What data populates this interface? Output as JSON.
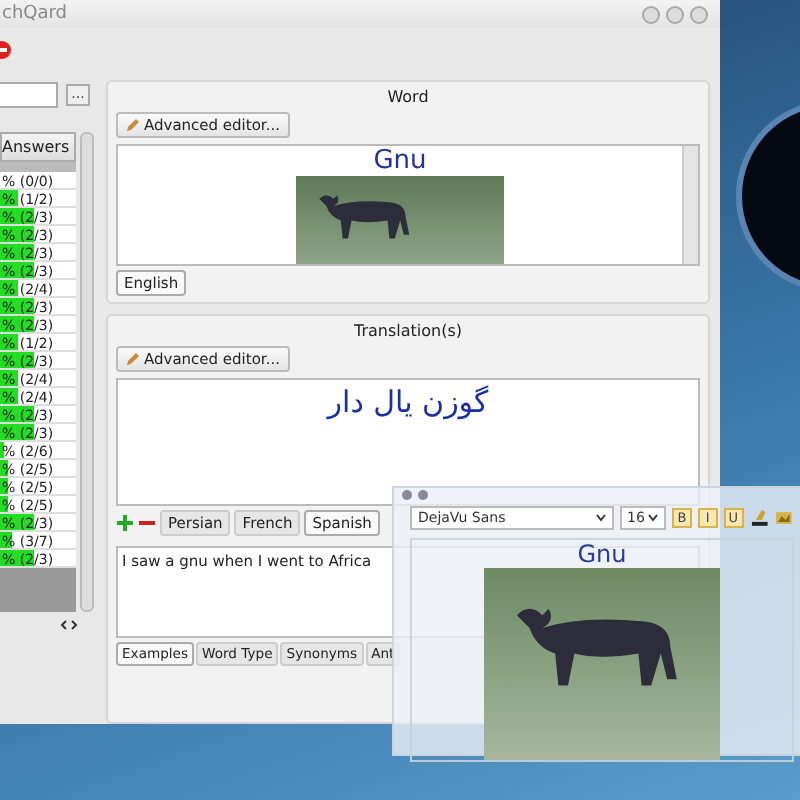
{
  "window": {
    "title": "chQard"
  },
  "search": {
    "button": "..."
  },
  "table": {
    "columns": [
      "Answers"
    ],
    "rows": [
      {
        "answers": "% (0/0)"
      },
      {
        "answers": "% (1/2)",
        "level": 0.25
      },
      {
        "answers": "% (2/3)",
        "level": 0.45
      },
      {
        "answers": "% (2/3)",
        "level": 0.45
      },
      {
        "answers": "% (2/3)",
        "level": 0.45
      },
      {
        "answers": "% (2/3)",
        "level": 0.45
      },
      {
        "answers": "% (2/4)",
        "level": 0.25
      },
      {
        "answers": "% (2/3)",
        "level": 0.45
      },
      {
        "answers": "% (2/3)",
        "level": 0.45
      },
      {
        "answers": "% (1/2)",
        "level": 0.25
      },
      {
        "answers": "% (2/3)",
        "level": 0.45
      },
      {
        "answers": "% (2/4)",
        "level": 0.25
      },
      {
        "answers": "% (2/4)",
        "level": 0.25
      },
      {
        "answers": "% (2/3)",
        "level": 0.45
      },
      {
        "answers": "% (2/3)",
        "level": 0.45
      },
      {
        "answers": "% (2/6)",
        "level": 0.05
      },
      {
        "answers": "% (2/5)",
        "level": 0.1
      },
      {
        "answers": "% (2/5)",
        "level": 0.1
      },
      {
        "answers": "% (2/5)",
        "level": 0.1
      },
      {
        "answers": "% (2/3)",
        "level": 0.45
      },
      {
        "answers": "% (3/7)",
        "level": 0.15
      },
      {
        "answers": "% (2/3)",
        "level": 0.45
      }
    ]
  },
  "word_panel": {
    "title": "Word",
    "editor_button": "Advanced editor...",
    "word": "Gnu",
    "tabs": [
      {
        "label": "English",
        "selected": true
      }
    ]
  },
  "translation_panel": {
    "title": "Translation(s)",
    "editor_button": "Advanced editor...",
    "translation": "گوزن یال دار",
    "tabs": [
      {
        "label": "Persian",
        "selected": false
      },
      {
        "label": "French",
        "selected": false
      },
      {
        "label": "Spanish",
        "selected": true
      }
    ]
  },
  "example": {
    "text": "I saw a gnu when I went to Africa"
  },
  "bottom_tabs": [
    {
      "label": "Examples",
      "selected": true
    },
    {
      "label": "Word Type",
      "selected": false
    },
    {
      "label": "Synonyms",
      "selected": false
    },
    {
      "label": "Ant",
      "selected": false
    }
  ],
  "editor_window": {
    "font": "DejaVu Sans",
    "size": "16",
    "format_buttons": [
      "B",
      "I",
      "U"
    ],
    "word": "Gnu"
  }
}
